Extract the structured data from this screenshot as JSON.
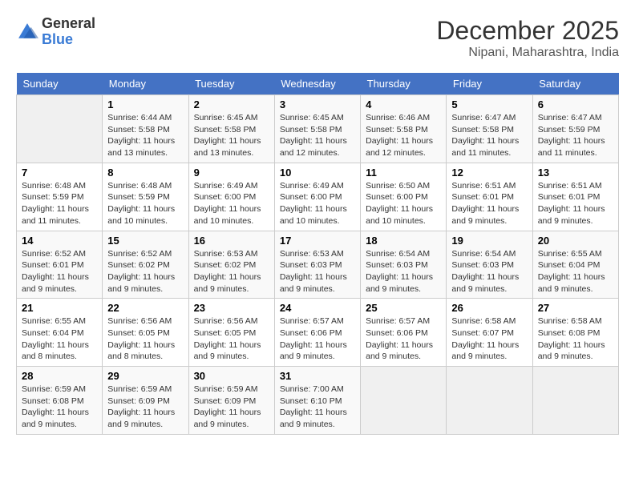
{
  "header": {
    "logo_general": "General",
    "logo_blue": "Blue",
    "month": "December 2025",
    "location": "Nipani, Maharashtra, India"
  },
  "weekdays": [
    "Sunday",
    "Monday",
    "Tuesday",
    "Wednesday",
    "Thursday",
    "Friday",
    "Saturday"
  ],
  "weeks": [
    [
      {
        "day": "",
        "info": ""
      },
      {
        "day": "1",
        "info": "Sunrise: 6:44 AM\nSunset: 5:58 PM\nDaylight: 11 hours\nand 13 minutes."
      },
      {
        "day": "2",
        "info": "Sunrise: 6:45 AM\nSunset: 5:58 PM\nDaylight: 11 hours\nand 13 minutes."
      },
      {
        "day": "3",
        "info": "Sunrise: 6:45 AM\nSunset: 5:58 PM\nDaylight: 11 hours\nand 12 minutes."
      },
      {
        "day": "4",
        "info": "Sunrise: 6:46 AM\nSunset: 5:58 PM\nDaylight: 11 hours\nand 12 minutes."
      },
      {
        "day": "5",
        "info": "Sunrise: 6:47 AM\nSunset: 5:58 PM\nDaylight: 11 hours\nand 11 minutes."
      },
      {
        "day": "6",
        "info": "Sunrise: 6:47 AM\nSunset: 5:59 PM\nDaylight: 11 hours\nand 11 minutes."
      }
    ],
    [
      {
        "day": "7",
        "info": "Sunrise: 6:48 AM\nSunset: 5:59 PM\nDaylight: 11 hours\nand 11 minutes."
      },
      {
        "day": "8",
        "info": "Sunrise: 6:48 AM\nSunset: 5:59 PM\nDaylight: 11 hours\nand 10 minutes."
      },
      {
        "day": "9",
        "info": "Sunrise: 6:49 AM\nSunset: 6:00 PM\nDaylight: 11 hours\nand 10 minutes."
      },
      {
        "day": "10",
        "info": "Sunrise: 6:49 AM\nSunset: 6:00 PM\nDaylight: 11 hours\nand 10 minutes."
      },
      {
        "day": "11",
        "info": "Sunrise: 6:50 AM\nSunset: 6:00 PM\nDaylight: 11 hours\nand 10 minutes."
      },
      {
        "day": "12",
        "info": "Sunrise: 6:51 AM\nSunset: 6:01 PM\nDaylight: 11 hours\nand 9 minutes."
      },
      {
        "day": "13",
        "info": "Sunrise: 6:51 AM\nSunset: 6:01 PM\nDaylight: 11 hours\nand 9 minutes."
      }
    ],
    [
      {
        "day": "14",
        "info": "Sunrise: 6:52 AM\nSunset: 6:01 PM\nDaylight: 11 hours\nand 9 minutes."
      },
      {
        "day": "15",
        "info": "Sunrise: 6:52 AM\nSunset: 6:02 PM\nDaylight: 11 hours\nand 9 minutes."
      },
      {
        "day": "16",
        "info": "Sunrise: 6:53 AM\nSunset: 6:02 PM\nDaylight: 11 hours\nand 9 minutes."
      },
      {
        "day": "17",
        "info": "Sunrise: 6:53 AM\nSunset: 6:03 PM\nDaylight: 11 hours\nand 9 minutes."
      },
      {
        "day": "18",
        "info": "Sunrise: 6:54 AM\nSunset: 6:03 PM\nDaylight: 11 hours\nand 9 minutes."
      },
      {
        "day": "19",
        "info": "Sunrise: 6:54 AM\nSunset: 6:03 PM\nDaylight: 11 hours\nand 9 minutes."
      },
      {
        "day": "20",
        "info": "Sunrise: 6:55 AM\nSunset: 6:04 PM\nDaylight: 11 hours\nand 9 minutes."
      }
    ],
    [
      {
        "day": "21",
        "info": "Sunrise: 6:55 AM\nSunset: 6:04 PM\nDaylight: 11 hours\nand 8 minutes."
      },
      {
        "day": "22",
        "info": "Sunrise: 6:56 AM\nSunset: 6:05 PM\nDaylight: 11 hours\nand 8 minutes."
      },
      {
        "day": "23",
        "info": "Sunrise: 6:56 AM\nSunset: 6:05 PM\nDaylight: 11 hours\nand 9 minutes."
      },
      {
        "day": "24",
        "info": "Sunrise: 6:57 AM\nSunset: 6:06 PM\nDaylight: 11 hours\nand 9 minutes."
      },
      {
        "day": "25",
        "info": "Sunrise: 6:57 AM\nSunset: 6:06 PM\nDaylight: 11 hours\nand 9 minutes."
      },
      {
        "day": "26",
        "info": "Sunrise: 6:58 AM\nSunset: 6:07 PM\nDaylight: 11 hours\nand 9 minutes."
      },
      {
        "day": "27",
        "info": "Sunrise: 6:58 AM\nSunset: 6:08 PM\nDaylight: 11 hours\nand 9 minutes."
      }
    ],
    [
      {
        "day": "28",
        "info": "Sunrise: 6:59 AM\nSunset: 6:08 PM\nDaylight: 11 hours\nand 9 minutes."
      },
      {
        "day": "29",
        "info": "Sunrise: 6:59 AM\nSunset: 6:09 PM\nDaylight: 11 hours\nand 9 minutes."
      },
      {
        "day": "30",
        "info": "Sunrise: 6:59 AM\nSunset: 6:09 PM\nDaylight: 11 hours\nand 9 minutes."
      },
      {
        "day": "31",
        "info": "Sunrise: 7:00 AM\nSunset: 6:10 PM\nDaylight: 11 hours\nand 9 minutes."
      },
      {
        "day": "",
        "info": ""
      },
      {
        "day": "",
        "info": ""
      },
      {
        "day": "",
        "info": ""
      }
    ]
  ]
}
